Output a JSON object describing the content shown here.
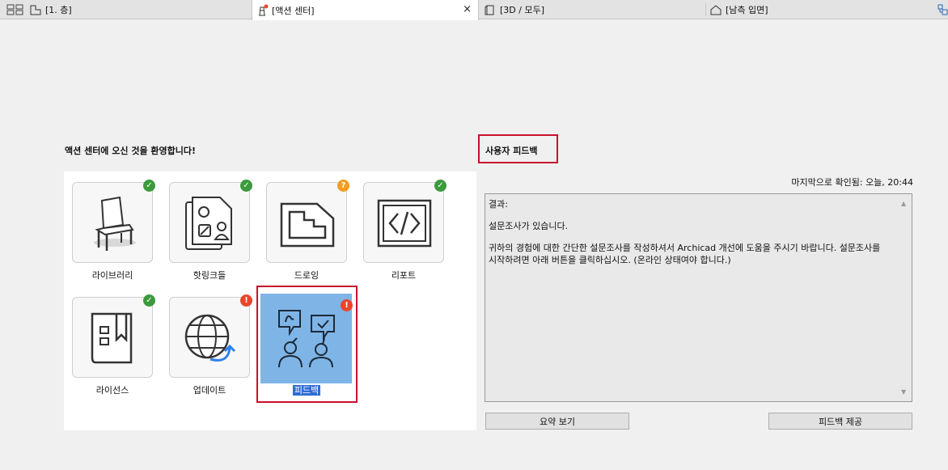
{
  "tabs": [
    {
      "label": "[1. 층]",
      "icon": "floor-plan-icon"
    },
    {
      "label": "[액션 센터]",
      "icon": "lighthouse-icon",
      "active": true
    },
    {
      "label": "[3D / 모두]",
      "icon": "3d-cube-icon"
    },
    {
      "label": "[남측 입면]",
      "icon": "elevation-icon"
    }
  ],
  "tab_close": "×",
  "welcome": "액션 센터에 오신 것을 환영합니다!",
  "tiles": [
    {
      "label": "라이브러리",
      "status": "ok",
      "badge": "✓"
    },
    {
      "label": "핫링크들",
      "status": "ok",
      "badge": "✓"
    },
    {
      "label": "드로잉",
      "status": "warning",
      "badge": "?"
    },
    {
      "label": "리포트",
      "status": "ok",
      "badge": "✓"
    },
    {
      "label": "라이선스",
      "status": "ok",
      "badge": "✓"
    },
    {
      "label": "업데이트",
      "status": "error",
      "badge": "!"
    },
    {
      "label": "피드백",
      "status": "error",
      "badge": "!",
      "selected": true
    }
  ],
  "feedback": {
    "title": "사용자 피드백",
    "last_checked": "마지막으로 확인됨: 오늘, 20:44",
    "result_heading": "결과:",
    "result_line1": "설문조사가 있습니다.",
    "result_line2": "귀하의 경험에 대한 간단한 설문조사를 작성하셔서 Archicad 개선에 도움을 주시기 바랍니다. 설문조사를 시작하려면 아래 버튼을 클릭하십시오. (온라인 상태여야 합니다.)",
    "summary_button": "요약 보기",
    "submit_button": "피드백 제공"
  },
  "colors": {
    "ok": "#3c9a3c",
    "warning": "#f39c1f",
    "error": "#e8462c",
    "selected_tile": "#7fb4e6",
    "highlight": "#c8102e"
  }
}
